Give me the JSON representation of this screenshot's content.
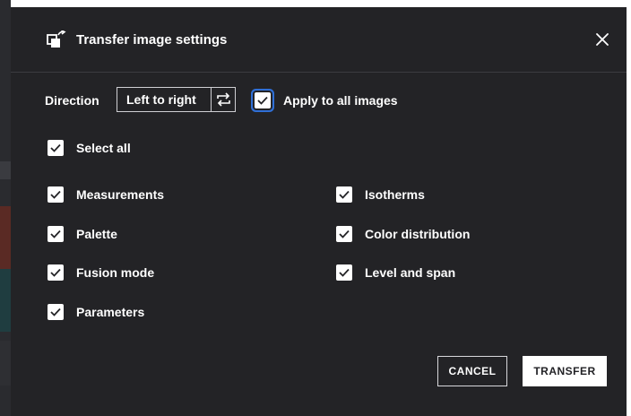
{
  "dialog": {
    "title": "Transfer image settings",
    "title_icon": "transfer-image-icon",
    "close_icon": "close-icon"
  },
  "direction": {
    "label": "Direction",
    "value": "Left to right",
    "swap_icon": "swap-arrows-icon"
  },
  "apply_all": {
    "label": "Apply to all images",
    "checked": true
  },
  "select_all": {
    "label": "Select all",
    "checked": true
  },
  "options": {
    "measurements": {
      "label": "Measurements",
      "checked": true
    },
    "palette": {
      "label": "Palette",
      "checked": true
    },
    "fusion_mode": {
      "label": "Fusion mode",
      "checked": true
    },
    "parameters": {
      "label": "Parameters",
      "checked": true
    },
    "isotherms": {
      "label": "Isotherms",
      "checked": true
    },
    "color_distribution": {
      "label": "Color distribution",
      "checked": true
    },
    "level_and_span": {
      "label": "Level and span",
      "checked": true
    }
  },
  "buttons": {
    "cancel": "CANCEL",
    "transfer": "TRANSFER"
  },
  "colors": {
    "dialog_bg": "#232326",
    "text": "#ffffff",
    "focus_ring": "#2f6fd6"
  }
}
